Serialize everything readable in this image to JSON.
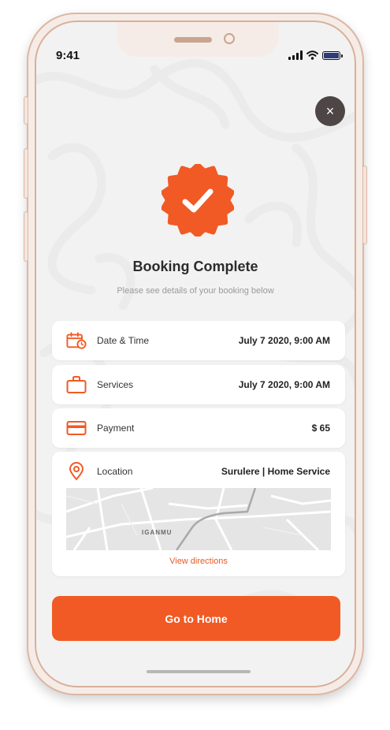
{
  "status_bar": {
    "time": "9:41"
  },
  "header": {
    "close_symbol": "×"
  },
  "booking": {
    "title": "Booking Complete",
    "subtitle": "Please see details of your booking below"
  },
  "details": [
    {
      "label": "Date & Time",
      "value": "July 7 2020, 9:00 AM",
      "icon": "calendar-clock-icon"
    },
    {
      "label": "Services",
      "value": "July 7 2020, 9:00 AM",
      "icon": "briefcase-icon"
    },
    {
      "label": "Payment",
      "value": "$ 65",
      "icon": "credit-card-icon"
    }
  ],
  "location": {
    "label": "Location",
    "value": "Surulere | Home Service",
    "icon": "location-pin-icon",
    "map_area": "IGANMU",
    "directions_label": "View directions"
  },
  "cta": {
    "label": "Go to Home"
  },
  "colors": {
    "accent": "#f15a24",
    "close_button": "#4e4644",
    "phone_frame": "#f6ece7"
  }
}
